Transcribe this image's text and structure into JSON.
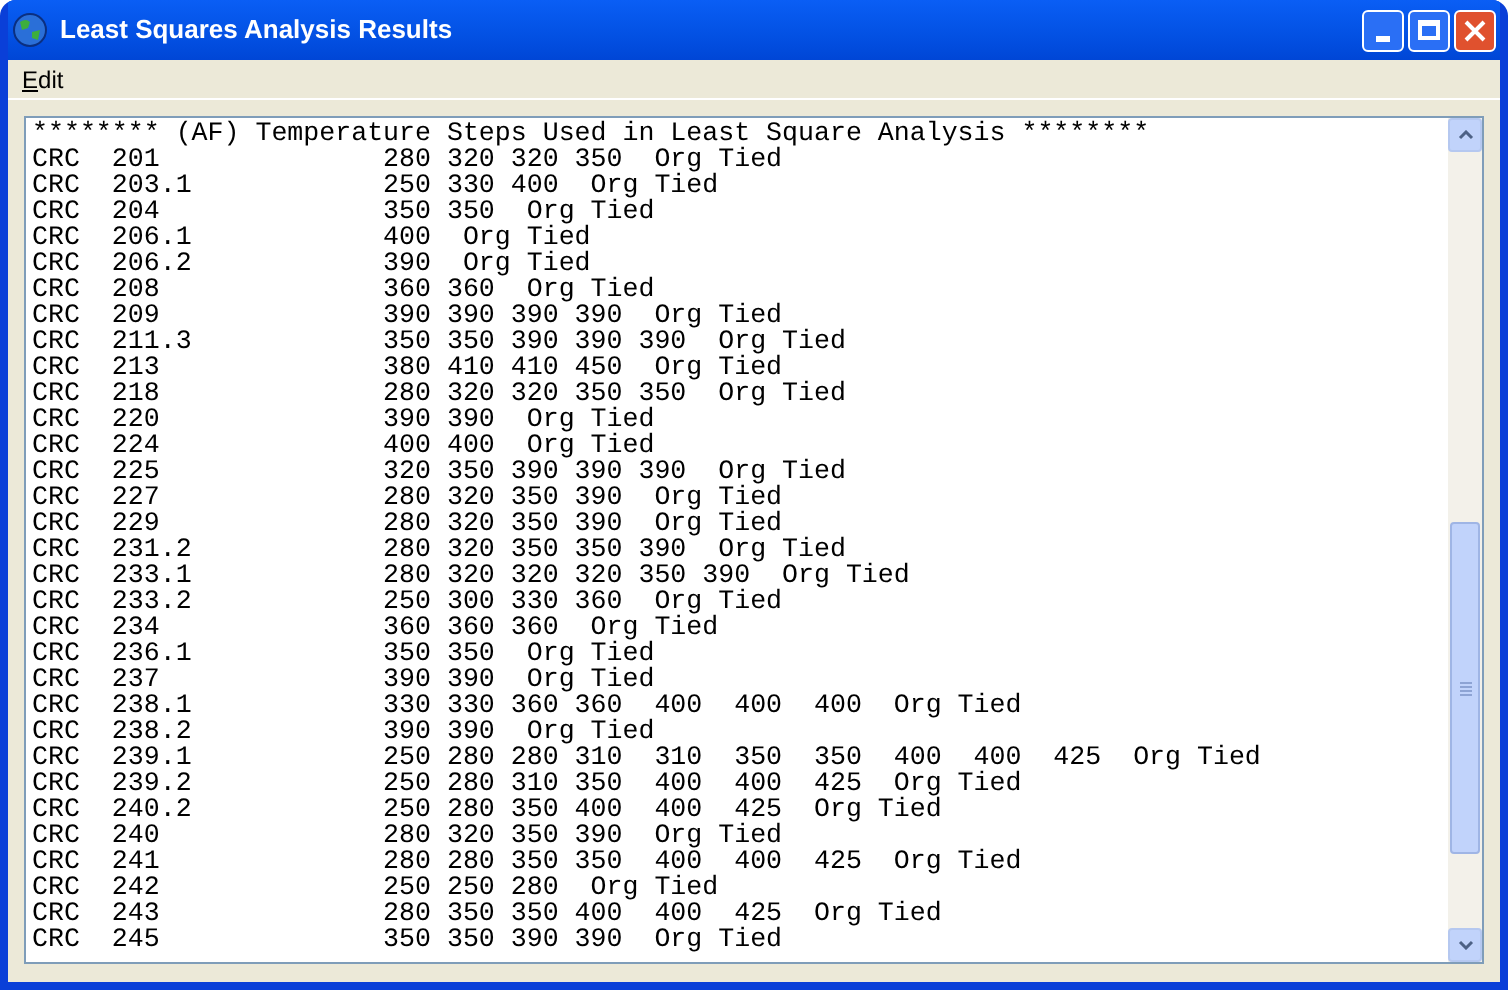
{
  "window": {
    "title": "Least Squares Analysis Results"
  },
  "menu": [
    {
      "label": "Edit"
    }
  ],
  "lines": [
    "******** (AF) Temperature Steps Used in Least Square Analysis ********",
    "CRC  201              280 320 320 350  Org Tied",
    "CRC  203.1            250 330 400  Org Tied",
    "CRC  204              350 350  Org Tied",
    "CRC  206.1            400  Org Tied",
    "CRC  206.2            390  Org Tied",
    "CRC  208              360 360  Org Tied",
    "CRC  209              390 390 390 390  Org Tied",
    "CRC  211.3            350 350 390 390 390  Org Tied",
    "CRC  213              380 410 410 450  Org Tied",
    "CRC  218              280 320 320 350 350  Org Tied",
    "CRC  220              390 390  Org Tied",
    "CRC  224              400 400  Org Tied",
    "CRC  225              320 350 390 390 390  Org Tied",
    "CRC  227              280 320 350 390  Org Tied",
    "CRC  229              280 320 350 390  Org Tied",
    "CRC  231.2            280 320 350 350 390  Org Tied",
    "CRC  233.1            280 320 320 320 350 390  Org Tied",
    "CRC  233.2            250 300 330 360  Org Tied",
    "CRC  234              360 360 360  Org Tied",
    "CRC  236.1            350 350  Org Tied",
    "CRC  237              390 390  Org Tied",
    "CRC  238.1            330 330 360 360  400  400  400  Org Tied",
    "CRC  238.2            390 390  Org Tied",
    "CRC  239.1            250 280 280 310  310  350  350  400  400  425  Org Tied",
    "CRC  239.2            250 280 310 350  400  400  425  Org Tied",
    "CRC  240.2            250 280 350 400  400  425  Org Tied",
    "CRC  240              280 320 350 390  Org Tied",
    "CRC  241              280 280 350 350  400  400  425  Org Tied",
    "CRC  242              250 250 280  Org Tied",
    "CRC  243              280 350 350 400  400  425  Org Tied",
    "CRC  245              350 350 390 390  Org Tied"
  ]
}
